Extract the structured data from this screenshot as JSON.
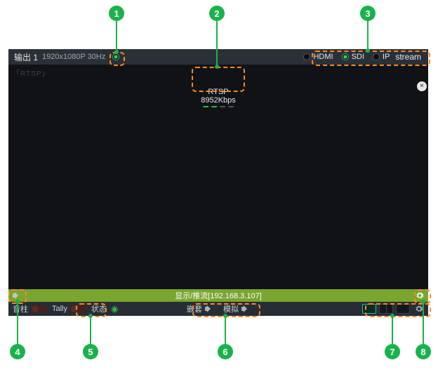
{
  "header": {
    "title": "输出 1",
    "resolution": "1920x1080P 30Hz",
    "power_icon_name": "power-icon",
    "outputs": {
      "hdmi": "HDMI",
      "sdi": "SDI",
      "ip": "IP",
      "stream": "stream"
    },
    "selected_output": "sdi"
  },
  "preview": {
    "corner_tag": "「RTSP」",
    "close_label": "×"
  },
  "rtsp": {
    "proto": "RTSP",
    "bitrate": "8952Kbps"
  },
  "stream_bar": {
    "label": "显示/推流[192.168.3.107]",
    "left_icon_name": "speaker-icon",
    "right_icon_name": "gear-icon"
  },
  "footer": {
    "meter_label": "音柱",
    "tally_label": "Tally",
    "status_label": "状态",
    "audio_sources": {
      "embed": "嵌套",
      "analog": "模拟"
    },
    "cog_icon_name": "gear-icon"
  },
  "callouts": {
    "1": "1",
    "2": "2",
    "3": "3",
    "4": "4",
    "5": "5",
    "6": "6",
    "7": "7",
    "8": "8"
  }
}
